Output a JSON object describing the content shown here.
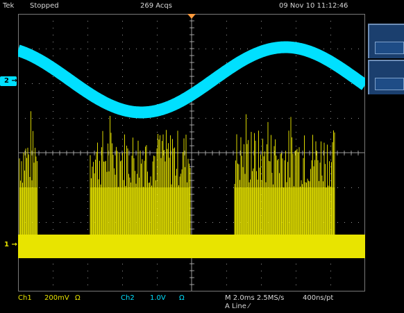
{
  "status_bar": {
    "brand": "Tek",
    "state": "Stopped",
    "acquisitions": "269 Acqs",
    "datetime": "09 Nov 10 11:12:46"
  },
  "markers": {
    "ch2": "2",
    "ch1": "1"
  },
  "readouts": {
    "ch1_label": "Ch1",
    "ch1_scale": "200mV",
    "ch1_coupling": "Ω",
    "ch2_label": "Ch2",
    "ch2_scale": "1.0V",
    "ch2_coupling": "Ω",
    "timebase": "M 2.0ms 2.5MS/s",
    "resolution": "400ns/pt",
    "trigger": "A  Line  ⁄"
  },
  "colors": {
    "ch1": "#e8e400",
    "ch2": "#00e0ff",
    "graticule": "#9a9a9a",
    "trigger_marker": "#ff9a3c",
    "side_menu": "#1b3f6e"
  },
  "side_menu": {
    "buttons": [
      "",
      ""
    ]
  },
  "chart_data": {
    "type": "line",
    "series": [
      {
        "name": "",
        "color": "#00e0ff",
        "shape": "sine",
        "cycles_on_screen": 1
      },
      {
        "name": "",
        "color": "#e8e400",
        "shape": "noise bursts"
      }
    ]
  }
}
